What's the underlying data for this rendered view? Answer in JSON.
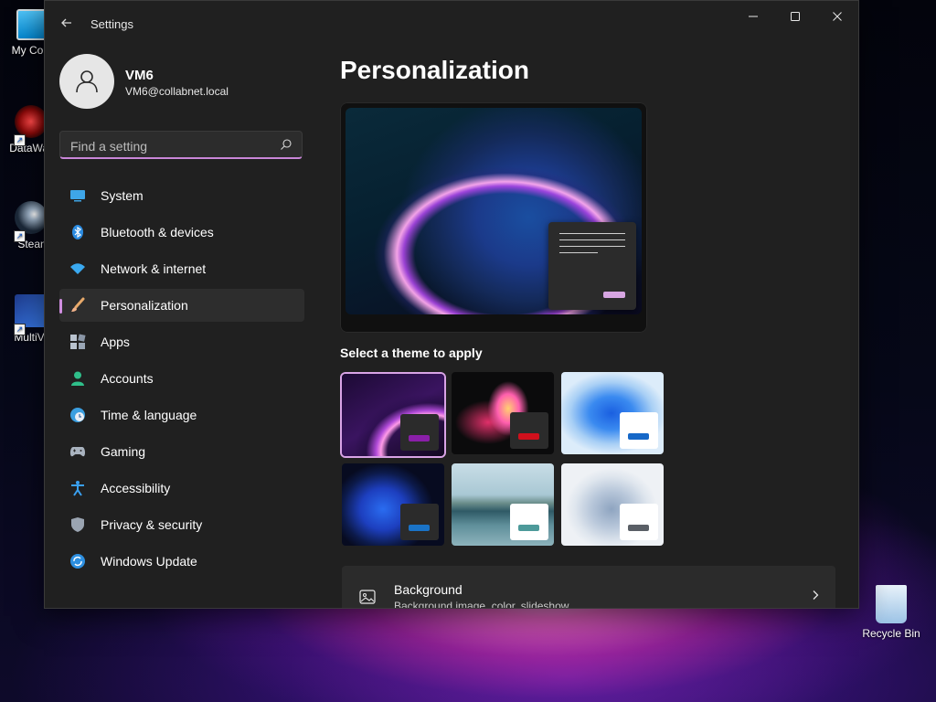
{
  "desktop": {
    "icons": [
      {
        "label": "My Com"
      },
      {
        "label": "DataWag"
      },
      {
        "label": "Stean"
      },
      {
        "label": "MultiVe"
      },
      {
        "label": "Recycle Bin"
      }
    ]
  },
  "window": {
    "title": "Settings",
    "controls": {
      "minimize": "minimize-icon",
      "maximize": "maximize-icon",
      "close": "close-icon"
    }
  },
  "profile": {
    "name": "VM6",
    "email": "VM6@collabnet.local"
  },
  "search": {
    "placeholder": "Find a setting",
    "value": ""
  },
  "nav": {
    "items": [
      {
        "label": "System",
        "icon": "system-icon"
      },
      {
        "label": "Bluetooth & devices",
        "icon": "bluetooth-icon"
      },
      {
        "label": "Network & internet",
        "icon": "network-icon"
      },
      {
        "label": "Personalization",
        "icon": "personalization-brush-icon",
        "active": true
      },
      {
        "label": "Apps",
        "icon": "apps-icon"
      },
      {
        "label": "Accounts",
        "icon": "accounts-icon"
      },
      {
        "label": "Time & language",
        "icon": "time-language-icon"
      },
      {
        "label": "Gaming",
        "icon": "gaming-icon"
      },
      {
        "label": "Accessibility",
        "icon": "accessibility-icon"
      },
      {
        "label": "Privacy & security",
        "icon": "privacy-shield-icon"
      },
      {
        "label": "Windows Update",
        "icon": "windows-update-icon"
      }
    ]
  },
  "main": {
    "title": "Personalization",
    "theme_section_label": "Select a theme to apply",
    "themes": [
      {
        "name": "theme-1",
        "selected": true,
        "accent": "#8a1fa8",
        "window": "#2b2b2b"
      },
      {
        "name": "theme-2",
        "accent": "#d0101c",
        "window": "#2b2b2b"
      },
      {
        "name": "theme-3",
        "accent": "#1668c8",
        "window": "#ffffff"
      },
      {
        "name": "theme-4",
        "accent": "#1a73c7",
        "window": "#2b2b2b"
      },
      {
        "name": "theme-5",
        "accent": "#4d9a9a",
        "window": "#ffffff"
      },
      {
        "name": "theme-6",
        "accent": "#5a5f66",
        "window": "#ffffff"
      }
    ],
    "background_card": {
      "title": "Background",
      "subtitle": "Background image, color, slideshow"
    }
  },
  "colors": {
    "accent": "#d08ee0",
    "window_bg": "#202020"
  }
}
